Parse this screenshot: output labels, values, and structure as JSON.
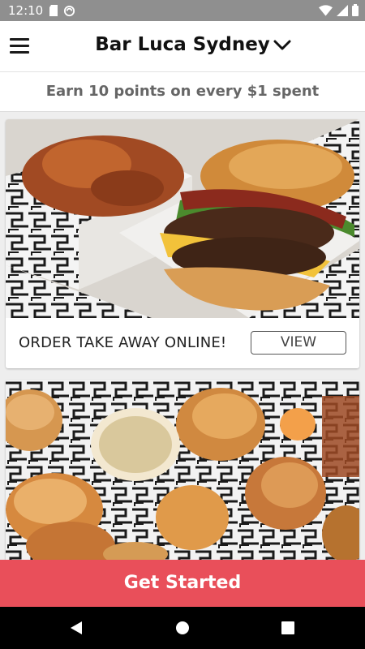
{
  "status_bar": {
    "time": "12:10",
    "left_icons": [
      "sd-card-icon",
      "sync-icon"
    ],
    "right_icons": [
      "wifi-icon",
      "signal-icon",
      "battery-icon"
    ]
  },
  "app_bar": {
    "title": "Bar Luca Sydney",
    "menu_icon": "hamburger-menu-icon",
    "dropdown_icon": "chevron-down-icon"
  },
  "earn_banner": {
    "text": "Earn 10 points on every $1 spent"
  },
  "cards": [
    {
      "image": "burger-and-fries-photo",
      "title": "ORDER TAKE AWAY ONLINE!",
      "button_label": "VIEW"
    },
    {
      "image": "burgers-spread-photo"
    }
  ],
  "cta": {
    "label": "Get Started",
    "color": "#e94f5a"
  },
  "nav_bar": {
    "icons": [
      "back-icon",
      "home-icon",
      "recents-icon"
    ]
  }
}
